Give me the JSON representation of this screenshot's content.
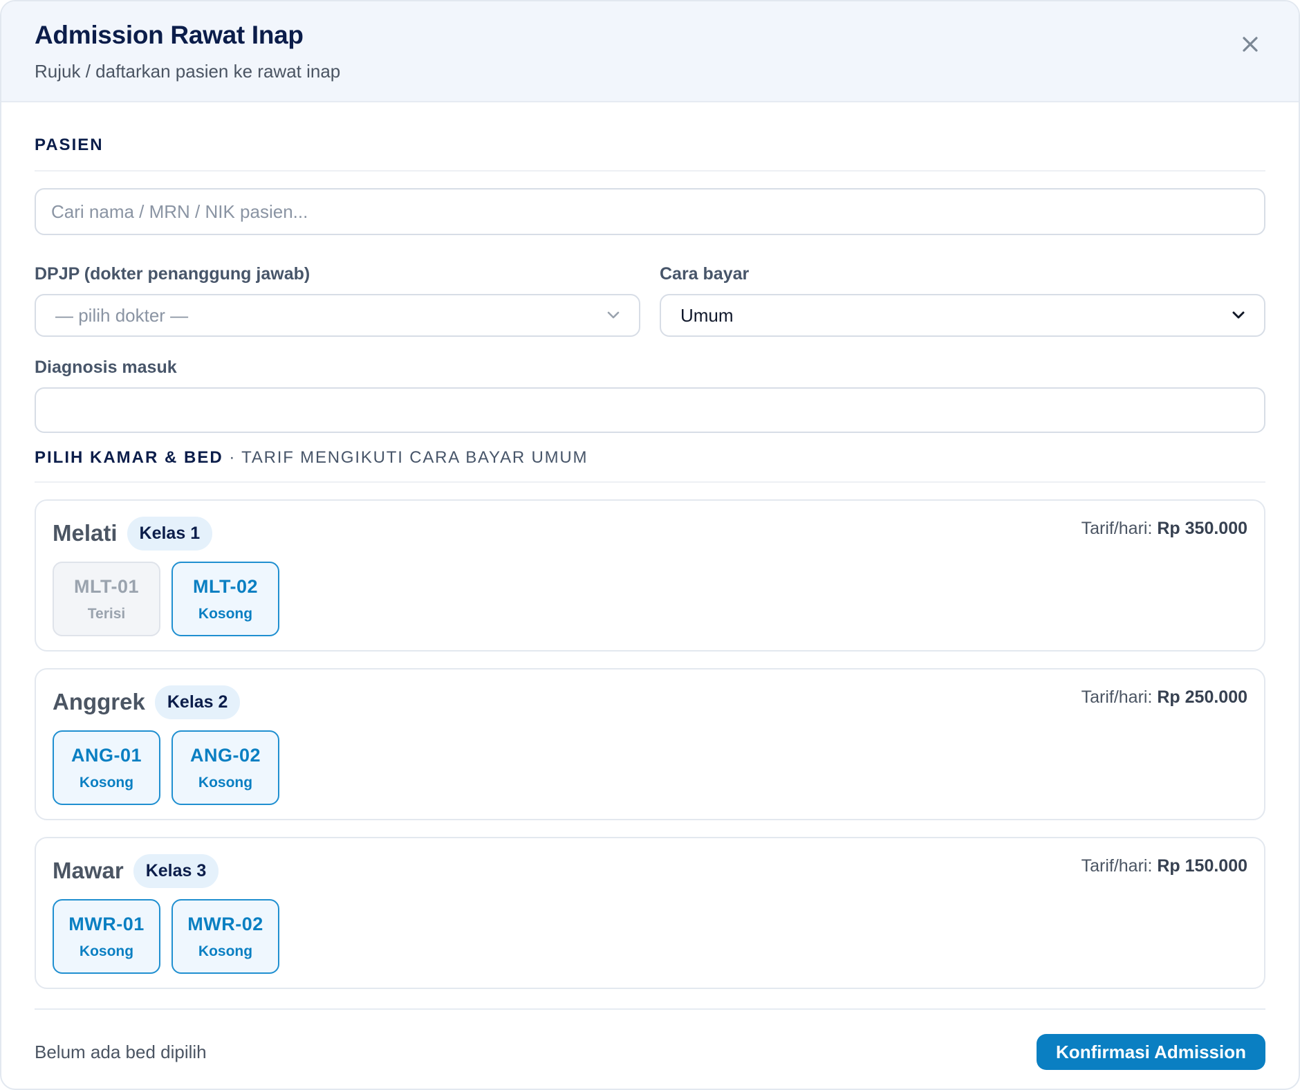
{
  "modal": {
    "title": "Admission Rawat Inap",
    "subtitle": "Rujuk / daftarkan pasien ke rawat inap",
    "close_icon": "close-icon"
  },
  "patient_section": {
    "heading": "PASIEN",
    "search_placeholder": "Cari nama / MRN / NIK pasien...",
    "search_value": "",
    "dpjp_label": "DPJP (dokter penanggung jawab)",
    "dpjp_value": "— pilih dokter —",
    "payment_label": "Cara bayar",
    "payment_value": "Umum",
    "diagnosis_label": "Diagnosis masuk",
    "diagnosis_value": ""
  },
  "rooms_section": {
    "heading": "PILIH KAMAR & BED",
    "subheading": "· TARIF MENGIKUTI CARA BAYAR UMUM",
    "tariff_label": "Tarif/hari:",
    "rooms": [
      {
        "name": "Melati",
        "class": "Kelas 1",
        "tariff": "Rp 350.000",
        "beds": [
          {
            "code": "MLT-01",
            "status": "Terisi"
          },
          {
            "code": "MLT-02",
            "status": "Kosong"
          }
        ]
      },
      {
        "name": "Anggrek",
        "class": "Kelas 2",
        "tariff": "Rp 250.000",
        "beds": [
          {
            "code": "ANG-01",
            "status": "Kosong"
          },
          {
            "code": "ANG-02",
            "status": "Kosong"
          }
        ]
      },
      {
        "name": "Mawar",
        "class": "Kelas 3",
        "tariff": "Rp 150.000",
        "beds": [
          {
            "code": "MWR-01",
            "status": "Kosong"
          },
          {
            "code": "MWR-02",
            "status": "Kosong"
          }
        ]
      }
    ]
  },
  "footer": {
    "note": "Belum ada bed dipilih",
    "confirm_label": "Konfirmasi Admission"
  },
  "colors": {
    "primary": "#0a7fc2",
    "heading": "#0b1d4a",
    "badge_bg": "#e5f1fb",
    "header_bg": "#f2f6fc"
  }
}
